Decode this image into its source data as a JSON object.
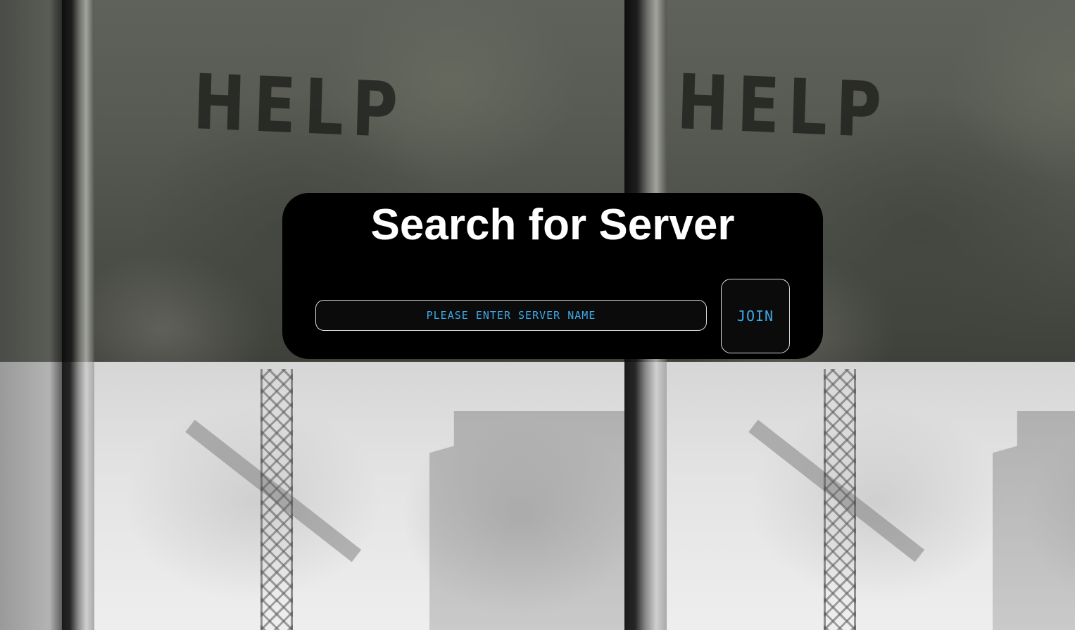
{
  "dialog": {
    "title": "Search for Server",
    "server_input": {
      "value": "",
      "placeholder": "PLEASE ENTER SERVER NAME"
    },
    "join_label": "JOIN"
  },
  "background": {
    "photo_text": "HELP",
    "tile_count": 4
  },
  "colors": {
    "accent_text": "#3fa9e6",
    "dialog_bg": "#000000",
    "title_text": "#ffffff",
    "control_border": "#d8d8d8"
  }
}
